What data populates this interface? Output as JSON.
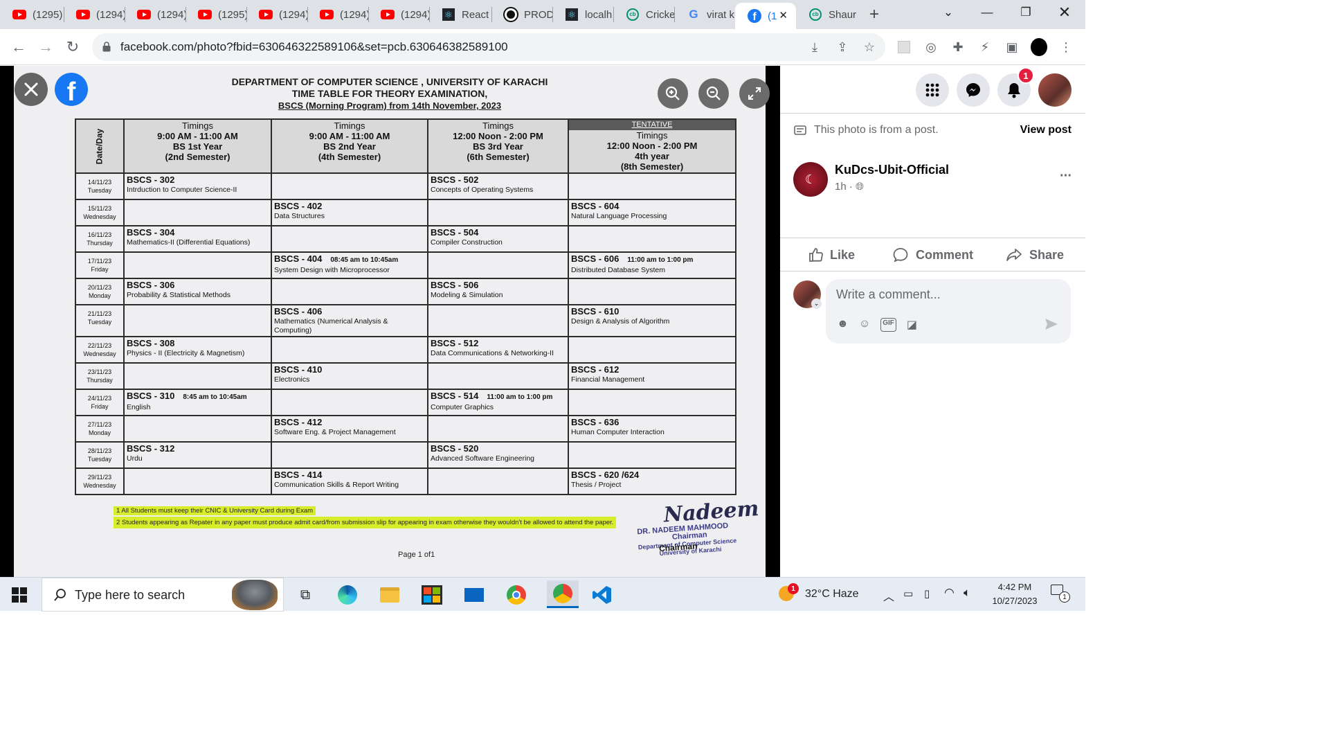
{
  "browser": {
    "tabs": [
      {
        "label": "(1295)",
        "icon": "youtube-icon"
      },
      {
        "label": "(1294)",
        "icon": "youtube-icon"
      },
      {
        "label": "(1294)",
        "icon": "youtube-icon"
      },
      {
        "label": "(1295)",
        "icon": "youtube-icon"
      },
      {
        "label": "(1294)",
        "icon": "youtube-icon"
      },
      {
        "label": "(1294)",
        "icon": "youtube-icon"
      },
      {
        "label": "(1294)",
        "icon": "youtube-icon"
      },
      {
        "label": "React",
        "icon": "react-icon"
      },
      {
        "label": "PROD",
        "icon": "circle-logo-icon"
      },
      {
        "label": "localh",
        "icon": "react-icon"
      },
      {
        "label": "Cricke",
        "icon": "cricbuzz-icon"
      },
      {
        "label": "virat k",
        "icon": "google-icon"
      },
      {
        "label": "(1",
        "icon": "facebook-icon"
      },
      {
        "label": "Shaur",
        "icon": "cricbuzz-icon"
      }
    ],
    "new_tab": "+",
    "url": "facebook.com/photo?fbid=630646322589106&set=pcb.630646382589100"
  },
  "notification_count": "1",
  "document": {
    "dept": "DEPARTMENT OF COMPUTER SCIENCE , UNIVERSITY OF KARACHI",
    "title": "TIME TABLE FOR THEORY EXAMINATION,",
    "subtitle": "BSCS (Morning Program) from 14th November, 2023",
    "table": {
      "date_header": "Date/Day",
      "tentative": "TENTATIVE",
      "columns": [
        {
          "timing_label": "Timings",
          "time": "9:00 AM - 11:00 AM",
          "year": "BS 1st Year",
          "semester": "(2nd  Semester)"
        },
        {
          "timing_label": "Timings",
          "time": "9:00 AM - 11:00 AM",
          "year": "BS 2nd Year",
          "semester": "(4th  Semester)"
        },
        {
          "timing_label": "Timings",
          "time": "12:00 Noon - 2:00 PM",
          "year": "BS 3rd Year",
          "semester": "(6th Semester)"
        },
        {
          "timing_label": "Timings",
          "time": "12:00 Noon - 2:00 PM",
          "year": "4th year",
          "semester": "(8th  Semester)"
        }
      ],
      "rows": [
        {
          "date": "14/11/23",
          "day": "Tuesday",
          "cells": [
            {
              "code": "BSCS - 302",
              "name": "Intrduction to Computer Science-II",
              "time": ""
            },
            {},
            {
              "code": "BSCS - 502",
              "name": "Concepts of Operating Systems",
              "time": ""
            },
            {}
          ]
        },
        {
          "date": "15/11/23",
          "day": "Wednesday",
          "cells": [
            {},
            {
              "code": "BSCS - 402",
              "name": "Data Structures",
              "time": ""
            },
            {},
            {
              "code": "BSCS - 604",
              "name": "Natural Language Processing",
              "time": ""
            }
          ]
        },
        {
          "date": "16/11/23",
          "day": "Thursday",
          "cells": [
            {
              "code": "BSCS - 304",
              "name": "Mathematics-II (Differential Equations)",
              "time": ""
            },
            {},
            {
              "code": "BSCS - 504",
              "name": "Compiler Construction",
              "time": ""
            },
            {}
          ]
        },
        {
          "date": "17/11/23",
          "day": "Friday",
          "cells": [
            {},
            {
              "code": "BSCS - 404",
              "name": "System Design with Microprocessor",
              "time": "08:45 am to 10:45am"
            },
            {},
            {
              "code": "BSCS - 606",
              "name": "Distributed Database System",
              "time": "11:00 am to 1:00 pm"
            }
          ]
        },
        {
          "date": "20/11/23",
          "day": "Monday",
          "cells": [
            {
              "code": "BSCS - 306",
              "name": "Probability & Statistical Methods",
              "time": ""
            },
            {},
            {
              "code": "BSCS - 506",
              "name": "Modeling & Simulation",
              "time": ""
            },
            {}
          ]
        },
        {
          "date": "21/11/23",
          "day": "Tuesday",
          "cells": [
            {},
            {
              "code": "BSCS - 406",
              "name": "Mathematics (Numerical Analysis & Computing)",
              "time": ""
            },
            {},
            {
              "code": "BSCS - 610",
              "name": "Design & Analysis of Algorithm",
              "time": ""
            }
          ]
        },
        {
          "date": "22/11/23",
          "day": "Wednesday",
          "cells": [
            {
              "code": "BSCS - 308",
              "name": "Physics - II (Electricity & Magnetism)",
              "time": ""
            },
            {},
            {
              "code": "BSCS - 512",
              "name": "Data Communications & Networking-II",
              "time": ""
            },
            {}
          ]
        },
        {
          "date": "23/11/23",
          "day": "Thursday",
          "cells": [
            {},
            {
              "code": "BSCS - 410",
              "name": "Electronics",
              "time": ""
            },
            {},
            {
              "code": "BSCS - 612",
              "name": "Financial Management",
              "time": ""
            }
          ]
        },
        {
          "date": "24/11/23",
          "day": "Friday",
          "cells": [
            {
              "code": "BSCS - 310",
              "name": "English",
              "time": "8:45 am to 10:45am"
            },
            {},
            {
              "code": "BSCS - 514",
              "name": "Computer Graphics",
              "time": "11:00 am to 1:00 pm"
            },
            {}
          ]
        },
        {
          "date": "27/11/23",
          "day": "Monday",
          "cells": [
            {},
            {
              "code": "BSCS - 412",
              "name": "Software Eng. & Project Management",
              "time": ""
            },
            {},
            {
              "code": "BSCS - 636",
              "name": "Human Computer Interaction",
              "time": ""
            }
          ]
        },
        {
          "date": "28/11/23",
          "day": "Tuesday",
          "cells": [
            {
              "code": "BSCS - 312",
              "name": "Urdu",
              "time": ""
            },
            {},
            {
              "code": "BSCS - 520",
              "name": "Advanced Software Engineering",
              "time": ""
            },
            {}
          ]
        },
        {
          "date": "29/11/23",
          "day": "Wednesday",
          "cells": [
            {},
            {
              "code": "BSCS - 414",
              "name": "Communication Skills & Report Writing",
              "time": ""
            },
            {},
            {
              "code": "BSCS - 620 /624",
              "name": "Thesis / Project",
              "time": ""
            }
          ]
        }
      ]
    },
    "notes": [
      "1  All Students must keep their CNIC & University Card during Exam",
      "2  Students appearing as Repater in any paper must produce admit card/from submission slip for appearing in exam otherwise they wouldn't be allowed to attend the paper."
    ],
    "stamp": [
      "DR. NADEEM MAHMOOD",
      "Chairman",
      "Department of Computer Science",
      "University of Karachi"
    ],
    "signature_label": "Chairman",
    "page": "Page 1 of1"
  },
  "post": {
    "from_post_text": "This photo is from a post.",
    "view_post": "View post",
    "author": "KuDcs-Ubit-Official",
    "time": "1h ·",
    "more": "···",
    "actions": {
      "like": "Like",
      "comment": "Comment",
      "share": "Share"
    },
    "comment_placeholder": "Write a comment..."
  },
  "taskbar": {
    "search_placeholder": "Type here to search",
    "weather_badge": "1",
    "weather": "32°C  Haze",
    "time": "4:42 PM",
    "date": "10/27/2023",
    "notification_count": "1"
  },
  "colors": {
    "facebook_blue": "#1877f2",
    "highlight": "#d7ec2a",
    "badge_red": "#e41e3f"
  }
}
